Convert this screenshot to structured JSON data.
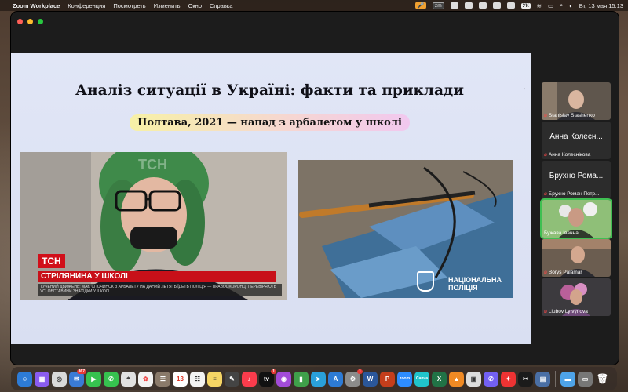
{
  "menubar": {
    "app_name": "Zoom Workplace",
    "menus": [
      "Конференция",
      "Посмотреть",
      "Изменить",
      "Окно",
      "Справка"
    ],
    "tray": {
      "badge": "zm",
      "keyboard": "УК",
      "datetime": "Вт, 13 мая  15:13"
    }
  },
  "slide": {
    "title": "Аналіз ситуації в Україні: факти та приклади",
    "subtitle": "Полтава, 2021 — напад з арбалетом у школі",
    "left_photo": {
      "logo": "ТСН",
      "headline": "СТРІЛЯНИНА У ШКОЛІ",
      "ticker": "ТУЧЕНИЙ ДВИЖЕНЬ: МАЄ СПОЧИНОК З АРБАЛЕТУ НА ДАНИЙ ЛЕТЯТЬ ЇДЕТЬ ПОЛІЦІЯ — ПРАВООХОРОНЦІ ПЕРЕВІРЯЮТЬ УСІ ОБСТАВИНИ ЗНАХІДКИ У ШКОЛІ",
      "watermark": "ТСН"
    },
    "right_photo": {
      "caption_line1": "НАЦІОНАЛЬНА",
      "caption_line2": "ПОЛІЦІЯ"
    },
    "next_arrow": "→"
  },
  "participants": [
    {
      "name": "Stanislav Stashenko",
      "muted": true,
      "video": true
    },
    {
      "big_name": "Анна Колесн...",
      "name": "Анна Колеснікова",
      "muted": true,
      "video": false
    },
    {
      "big_name": "Брухно Рома...",
      "name": "Брухно Роман Петр...",
      "muted": true,
      "video": false
    },
    {
      "name": "Бужава Іванна",
      "muted": false,
      "video": true,
      "active": true
    },
    {
      "name": "Borys Palamar",
      "muted": true,
      "video": true
    },
    {
      "name": "Liubov Lytvynova",
      "muted": true,
      "video": true
    }
  ],
  "dock": {
    "calendar_day": "13",
    "mail_badge": "367",
    "appletv_badge": "1",
    "settings_badge": "1",
    "app_labels": [
      "zoom",
      "Canva"
    ]
  }
}
